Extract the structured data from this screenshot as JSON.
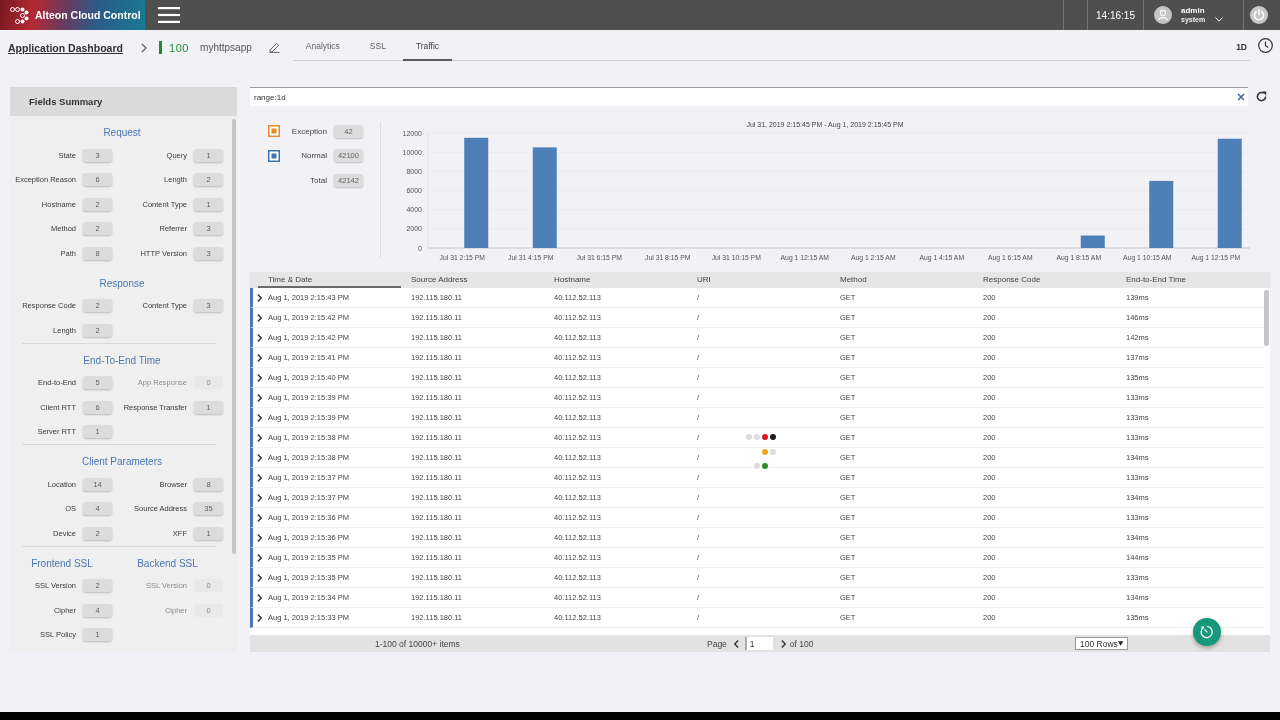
{
  "app": {
    "title": "Alteon Cloud Control"
  },
  "top_bar": {
    "time": "14:16:15",
    "user": {
      "name": "admin",
      "role": "system"
    }
  },
  "breadcrumb": {
    "root": "Application Dashboard",
    "app_id": "100",
    "app_name": "myhttpsapp"
  },
  "tabs": [
    {
      "label": "Analytics",
      "selected": false
    },
    {
      "label": "SSL",
      "selected": false
    },
    {
      "label": "Traffic",
      "selected": true
    }
  ],
  "time_range": "1D",
  "fields_summary": {
    "title": "Fields Summary",
    "sections": [
      {
        "kind": "rows",
        "blocks": [
          {
            "title": "Request",
            "fields": [
              {
                "label": "State",
                "count": "3",
                "disabled": false
              },
              {
                "label": "Query",
                "count": "1",
                "disabled": false
              },
              {
                "label": "Exception Reason",
                "count": "6",
                "disabled": false
              },
              {
                "label": "Length",
                "count": "2",
                "disabled": false
              },
              {
                "label": "Hostname",
                "count": "2",
                "disabled": false
              },
              {
                "label": "Content Type",
                "count": "1",
                "disabled": false
              },
              {
                "label": "Method",
                "count": "2",
                "disabled": false
              },
              {
                "label": "Referrer",
                "count": "3",
                "disabled": false
              },
              {
                "label": "Path",
                "count": "8",
                "disabled": false
              },
              {
                "label": "HTTP Version",
                "count": "3",
                "disabled": false
              }
            ]
          },
          {
            "title": "Response",
            "fields": [
              {
                "label": "Response Code",
                "count": "2",
                "disabled": false
              },
              {
                "label": "Content Type",
                "count": "3",
                "disabled": false
              },
              {
                "label": "Length",
                "count": "2",
                "disabled": false
              }
            ]
          }
        ]
      },
      {
        "kind": "rows",
        "blocks": [
          {
            "title": "End-To-End Time",
            "fields": [
              {
                "label": "End-to-End",
                "count": "5",
                "disabled": false
              },
              {
                "label": "App Response",
                "count": "0",
                "disabled": true
              },
              {
                "label": "Client RTT",
                "count": "6",
                "disabled": false
              },
              {
                "label": "Response Transfer",
                "count": "1",
                "disabled": false
              },
              {
                "label": "Server RTT",
                "count": "1",
                "disabled": false
              }
            ]
          }
        ]
      },
      {
        "kind": "rows",
        "blocks": [
          {
            "title": "Client Parameters",
            "fields": [
              {
                "label": "Location",
                "count": "14",
                "disabled": false
              },
              {
                "label": "Browser",
                "count": "8",
                "disabled": false
              },
              {
                "label": "OS",
                "count": "4",
                "disabled": false
              },
              {
                "label": "Source Address",
                "count": "35",
                "disabled": false
              },
              {
                "label": "Device",
                "count": "2",
                "disabled": false
              },
              {
                "label": "XFF",
                "count": "1",
                "disabled": false
              }
            ]
          }
        ]
      },
      {
        "kind": "columns",
        "blocks": [
          {
            "title": "Frontend SSL",
            "fields": [
              {
                "label": "SSL Version",
                "count": "2",
                "disabled": false
              },
              {
                "label": "Cipher",
                "count": "4",
                "disabled": false
              },
              {
                "label": "SSL Policy",
                "count": "1",
                "disabled": false
              }
            ]
          },
          {
            "title": "Backend SSL",
            "fields": [
              {
                "label": "SSL Version",
                "count": "0",
                "disabled": true
              },
              {
                "label": "Cipher",
                "count": "0",
                "disabled": true
              }
            ]
          }
        ]
      }
    ]
  },
  "search": {
    "value": "range:1d"
  },
  "traffic_chart": {
    "legend": [
      {
        "kind": "series",
        "label": "Exception",
        "count": "42",
        "color": "#e8892b"
      },
      {
        "kind": "series",
        "label": "Normal",
        "count": "42100",
        "color": "#3f73b0"
      },
      {
        "kind": "total",
        "label": "Total",
        "count": "42142"
      }
    ],
    "chart_data": [
      {
        "type": "bar",
        "title": "Jul 31, 2019 2:15:45 PM - Aug 1, 2019 2:15:45 PM",
        "categories": [
          "Jul 31 2:15 PM",
          "Jul 31 4:15 PM",
          "Jul 31 6:15 PM",
          "Jul 31 8:15 PM",
          "Jul 31 10:15 PM",
          "Aug 1 12:15 AM",
          "Aug 1 2:15 AM",
          "Aug 1 4:15 AM",
          "Aug 1 6:15 AM",
          "Aug 1 8:15 AM",
          "Aug 1 10:15 AM",
          "Aug 1 12:15 PM"
        ],
        "values": [
          11500,
          10500,
          0,
          0,
          0,
          0,
          0,
          0,
          0,
          1300,
          7000,
          11400
        ],
        "color": "#4f7fb8",
        "ylim": [
          0,
          12000
        ],
        "yticks": [
          0,
          2000,
          4000,
          6000,
          8000,
          10000,
          12000
        ],
        "grid": true
      }
    ]
  },
  "table": {
    "columns": [
      {
        "label": "Time & Date",
        "sorted": true
      },
      {
        "label": "Source Address",
        "sorted": false
      },
      {
        "label": "Hostname",
        "sorted": false
      },
      {
        "label": "URI",
        "sorted": false
      },
      {
        "label": "Method",
        "sorted": false
      },
      {
        "label": "Response Code",
        "sorted": false
      },
      {
        "label": "End-to-End Time",
        "sorted": false
      }
    ],
    "rows": [
      {
        "expanded": false,
        "cells": [
          "Aug 1, 2019 2:15:43 PM",
          "192.115.180.11",
          "40.112.52.113",
          "/",
          "GET",
          "200",
          "139ms"
        ]
      },
      {
        "expanded": false,
        "cells": [
          "Aug 1, 2019 2:15:42 PM",
          "192.115.180.11",
          "40.112.52.113",
          "/",
          "GET",
          "200",
          "146ms"
        ]
      },
      {
        "expanded": false,
        "cells": [
          "Aug 1, 2019 2:15:42 PM",
          "192.115.180.11",
          "40.112.52.113",
          "/",
          "GET",
          "200",
          "142ms"
        ]
      },
      {
        "expanded": false,
        "cells": [
          "Aug 1, 2019 2:15:41 PM",
          "192.115.180.11",
          "40.112.52.113",
          "/",
          "GET",
          "200",
          "137ms"
        ]
      },
      {
        "expanded": false,
        "cells": [
          "Aug 1, 2019 2:15:40 PM",
          "192.115.180.11",
          "40.112.52.113",
          "/",
          "GET",
          "200",
          "135ms"
        ]
      },
      {
        "expanded": false,
        "cells": [
          "Aug 1, 2019 2:15:39 PM",
          "192.115.180.11",
          "40.112.52.113",
          "/",
          "GET",
          "200",
          "133ms"
        ]
      },
      {
        "expanded": false,
        "cells": [
          "Aug 1, 2019 2:15:39 PM",
          "192.115.180.11",
          "40.112.52.113",
          "/",
          "GET",
          "200",
          "133ms"
        ]
      },
      {
        "expanded": false,
        "cells": [
          "Aug 1, 2019 2:15:38 PM",
          "192.115.180.11",
          "40.112.52.113",
          "/",
          "GET",
          "200",
          "133ms"
        ]
      },
      {
        "expanded": false,
        "cells": [
          "Aug 1, 2019 2:15:38 PM",
          "192.115.180.11",
          "40.112.52.113",
          "/",
          "GET",
          "200",
          "134ms"
        ]
      },
      {
        "expanded": false,
        "cells": [
          "Aug 1, 2019 2:15:37 PM",
          "192.115.180.11",
          "40.112.52.113",
          "/",
          "GET",
          "200",
          "133ms"
        ]
      },
      {
        "expanded": false,
        "cells": [
          "Aug 1, 2019 2:15:37 PM",
          "192.115.180.11",
          "40.112.52.113",
          "/",
          "GET",
          "200",
          "134ms"
        ]
      },
      {
        "expanded": false,
        "cells": [
          "Aug 1, 2019 2:15:36 PM",
          "192.115.180.11",
          "40.112.52.113",
          "/",
          "GET",
          "200",
          "133ms"
        ]
      },
      {
        "expanded": false,
        "cells": [
          "Aug 1, 2019 2:15:36 PM",
          "192.115.180.11",
          "40.112.52.113",
          "/",
          "GET",
          "200",
          "134ms"
        ]
      },
      {
        "expanded": false,
        "cells": [
          "Aug 1, 2019 2:15:35 PM",
          "192.115.180.11",
          "40.112.52.113",
          "/",
          "GET",
          "200",
          "144ms"
        ]
      },
      {
        "expanded": false,
        "cells": [
          "Aug 1, 2019 2:15:35 PM",
          "192.115.180.11",
          "40.112.52.113",
          "/",
          "GET",
          "200",
          "133ms"
        ]
      },
      {
        "expanded": false,
        "cells": [
          "Aug 1, 2019 2:15:34 PM",
          "192.115.180.11",
          "40.112.52.113",
          "/",
          "GET",
          "200",
          "134ms"
        ]
      },
      {
        "expanded": false,
        "cells": [
          "Aug 1, 2019 2:15:33 PM",
          "192.115.180.11",
          "40.112.52.113",
          "/",
          "GET",
          "200",
          "135ms"
        ]
      }
    ],
    "footer": {
      "summary": "1-100 of 10000+ items",
      "page_label": "Page",
      "page": "1",
      "page_count": "of 100",
      "rows_per_page": "100 Rows"
    }
  }
}
